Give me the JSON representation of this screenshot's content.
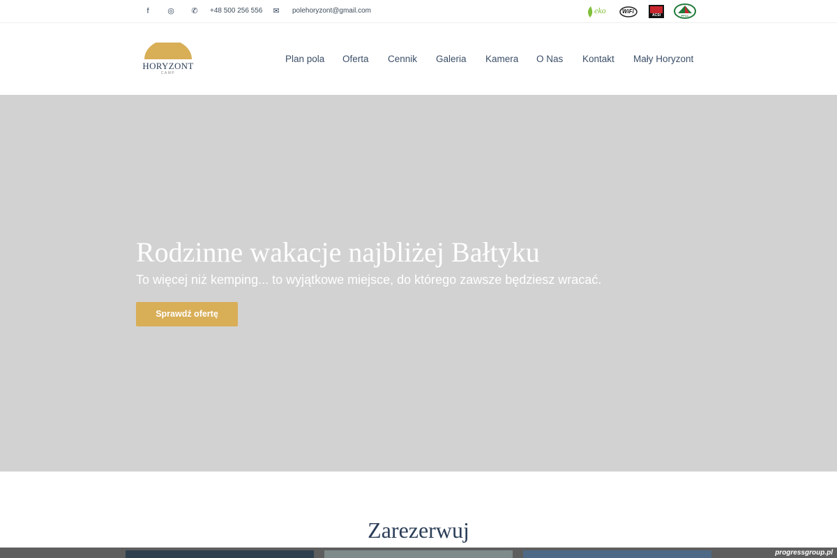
{
  "topbar": {
    "facebook_icon": "f",
    "instagram_icon": "◎",
    "phone_icon": "✆",
    "phone": "+48 500 256 556",
    "mail_icon": "✉",
    "email": "polehoryzont@gmail.com",
    "badges": {
      "eko": "eko",
      "wifi": "WiFi",
      "acsi": "ACSI",
      "camping": "PFCC"
    }
  },
  "header": {
    "logo_name": "HORYZONT",
    "logo_sub": "CAMP",
    "nav": [
      "Plan pola",
      "Oferta",
      "Cennik",
      "Galeria",
      "Kamera",
      "O Nas",
      "Kontakt",
      "Mały Horyzont"
    ]
  },
  "hero": {
    "title": "Rodzinne wakacje najbliżej Bałtyku",
    "subtitle": "To więcej niż kemping... to wyjątkowe miejsce, do którego zawsze będziesz wracać.",
    "button": "Sprawdź ofertę"
  },
  "reserve": {
    "title": "Zarezerwuj"
  },
  "watermark": "progressgroup.pl",
  "colors": {
    "accent": "#d8ae57",
    "navy": "#2b3e57",
    "hero_bg": "#d2d2d2"
  }
}
